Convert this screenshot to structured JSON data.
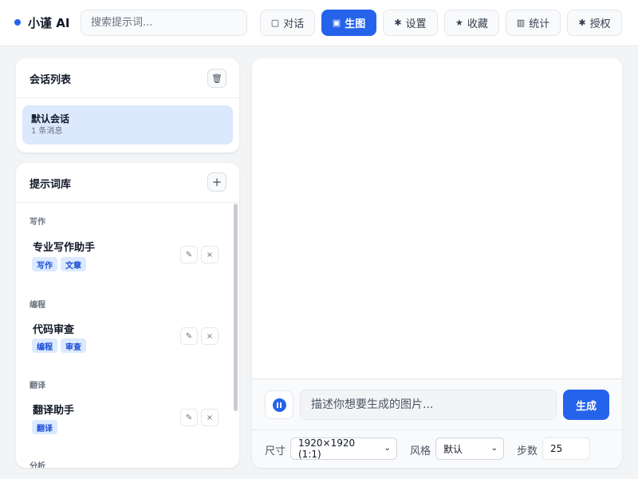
{
  "brand": {
    "name": "小谨 AI"
  },
  "search": {
    "placeholder": "搜索提示词..."
  },
  "nav": [
    {
      "icon": "▢",
      "label": "对话"
    },
    {
      "icon": "▣",
      "label": "生图"
    },
    {
      "icon": "✱",
      "label": "设置"
    },
    {
      "icon": "★",
      "label": "收藏"
    },
    {
      "icon": "▥",
      "label": "统计"
    },
    {
      "icon": "✱",
      "label": "授权"
    }
  ],
  "sessions": {
    "title": "会话列表",
    "delete_icon": "🗑",
    "items": [
      {
        "name": "默认会话",
        "meta": "1 条消息"
      }
    ]
  },
  "library": {
    "title": "提示词库",
    "add_icon": "+",
    "edit_icon": "✎",
    "remove_icon": "×",
    "groups": [
      {
        "label": "写作",
        "prompt": "专业写作助手",
        "tags": [
          "写作",
          "文章"
        ]
      },
      {
        "label": "编程",
        "prompt": "代码审查",
        "tags": [
          "编程",
          "审查"
        ]
      },
      {
        "label": "翻译",
        "prompt": "翻译助手",
        "tags": [
          "翻译"
        ]
      },
      {
        "label": "分析",
        "prompt": "",
        "tags": []
      }
    ]
  },
  "composer": {
    "placeholder": "描述你想要生成的图片...",
    "generate_label": "生成",
    "size_label": "尺寸",
    "size_value": "1920×1920 (1:1)",
    "style_label": "风格",
    "style_value": "默认",
    "steps_label": "步数",
    "steps_value": "25",
    "chevron": "⌄"
  },
  "colors": {
    "accent": "#2563eb",
    "tag_bg": "#dbeafe",
    "selected_bg": "#dbe8fd"
  }
}
